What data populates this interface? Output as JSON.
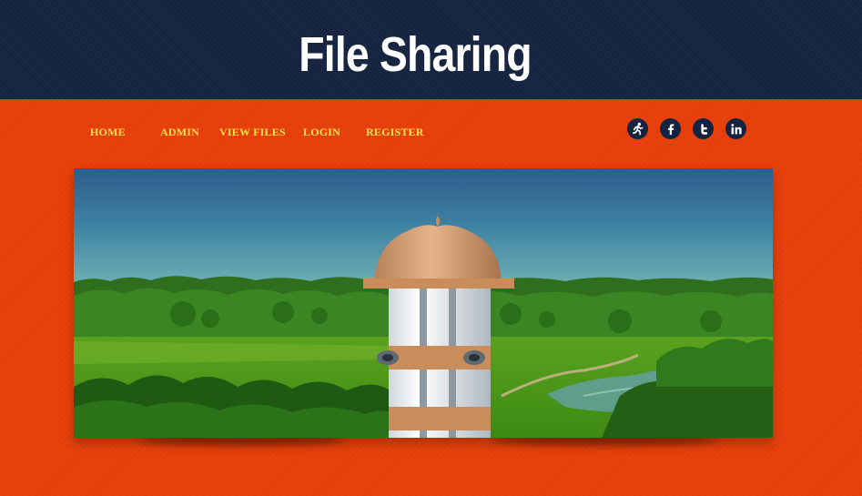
{
  "header": {
    "title": "File Sharing"
  },
  "nav": {
    "items": [
      {
        "label": "HOME"
      },
      {
        "label": "ADMIN"
      },
      {
        "label": "VIEW FILES"
      },
      {
        "label": "LOGIN"
      },
      {
        "label": "REGISTER"
      }
    ]
  },
  "social": {
    "icons": [
      "runner-icon",
      "facebook-icon",
      "twitter-icon",
      "linkedin-icon"
    ]
  },
  "colors": {
    "header_bg": "#14233f",
    "page_bg": "#e8410c",
    "nav_text": "#ffe14a",
    "title_text": "#ffffff"
  }
}
